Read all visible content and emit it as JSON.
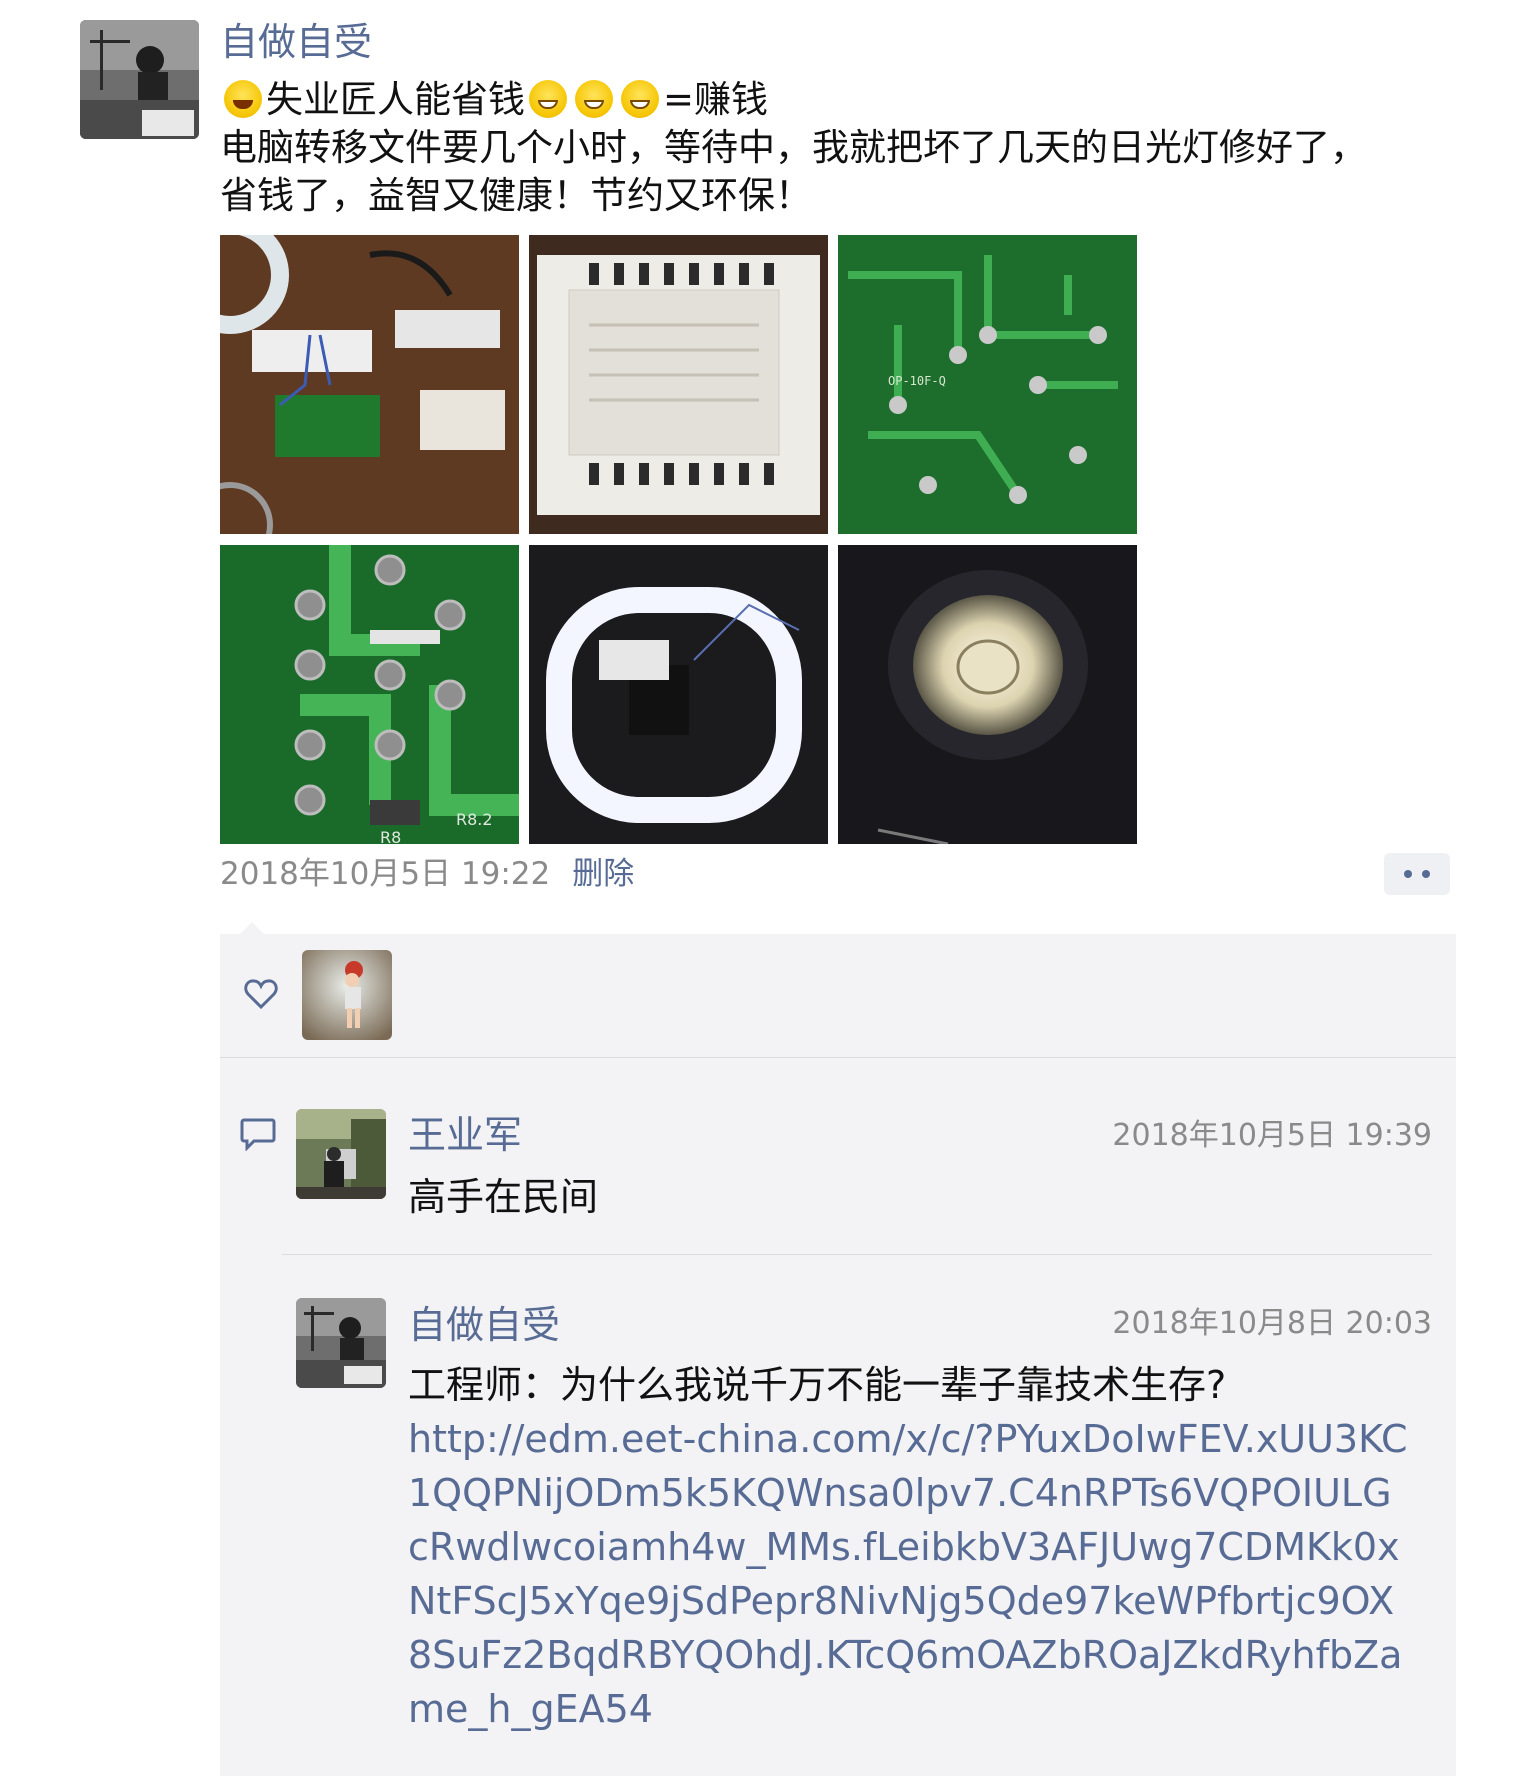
{
  "post": {
    "author": "自做自受",
    "text_line1_a": "失业匠人能省钱",
    "text_line1_b": "=赚钱",
    "text_line2": "电脑转移文件要几个小时，等待中，我就把坏了几天的日光灯修好了，",
    "text_line3": "省钱了，益智又健康！节约又环保！",
    "emojis": [
      "grin-emoji",
      "grimace-emoji",
      "grimace-emoji",
      "grimace-emoji"
    ],
    "photo_labels": [
      "OP-10F-Q",
      "R8.2",
      "R8"
    ],
    "timestamp": "2018年10月5日 19:22",
    "delete_label": "删除"
  },
  "likes": {
    "icon": "heart-icon"
  },
  "comments": [
    {
      "name": "王业军",
      "time": "2018年10月5日 19:39",
      "text": "高手在民间"
    },
    {
      "name": "自做自受",
      "time": "2018年10月8日 20:03",
      "text": "工程师：为什么我说千万不能一辈子靠技术生存?",
      "link": "http://edm.eet-china.com/x/c/?PYuxDoIwFEV.xUU3KC1QQPNijODm5k5KQWnsa0lpv7.C4nRPTs6VQPOIULGcRwdlwcoiamh4w_MMs.fLeibkbV3AFJUwg7CDMKk0xNtFScJ5xYqe9jSdPepr8NivNjg5Qde97keWPfbrtjc9OX8SuFz2BqdRBYQOhdJ.KTcQ6mOAZbROaJZkdRyhfbZame_h_gEA54"
    }
  ],
  "colors": {
    "link": "#576b95",
    "meta": "#8a8a8a",
    "comment_bg": "#f3f3f5"
  }
}
